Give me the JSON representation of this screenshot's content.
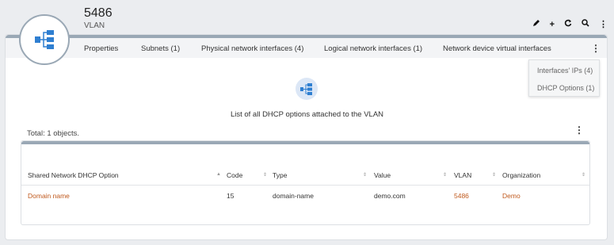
{
  "header": {
    "title": "5486",
    "subtitle": "VLAN",
    "actions": [
      {
        "name": "edit-icon",
        "glyph": "✎"
      },
      {
        "name": "add-icon",
        "glyph": "+"
      },
      {
        "name": "refresh-icon",
        "glyph": "↻"
      },
      {
        "name": "search-icon",
        "glyph": "⚲"
      },
      {
        "name": "more-icon",
        "glyph": "⋮"
      }
    ]
  },
  "tabs": [
    {
      "label": "Properties"
    },
    {
      "label": "Subnets (1)"
    },
    {
      "label": "Physical network interfaces (4)"
    },
    {
      "label": "Logical network interfaces (1)"
    },
    {
      "label": "Network device virtual interfaces"
    }
  ],
  "dropdown": {
    "items": [
      {
        "label": "Interfaces' IPs (4)"
      },
      {
        "label": "DHCP Options (1)"
      }
    ]
  },
  "main": {
    "description": "List of all DHCP options attached to the VLAN",
    "total": "Total: 1 objects."
  },
  "table": {
    "columns": [
      {
        "label": "Shared Network DHCP Option",
        "sort": "▲"
      },
      {
        "label": "Code",
        "sort": "⇕"
      },
      {
        "label": "Type",
        "sort": "⇕"
      },
      {
        "label": "Value",
        "sort": "⇕"
      },
      {
        "label": "VLAN",
        "sort": "⇕"
      },
      {
        "label": "Organization",
        "sort": "⇕"
      }
    ],
    "rows": [
      {
        "option": "Domain name",
        "code": "15",
        "type": "domain-name",
        "value": "demo.com",
        "vlan": "5486",
        "organization": "Demo"
      }
    ]
  },
  "colors": {
    "accent": "#3b82d6",
    "link": "#c05a1e",
    "bar": "#9aa8b5"
  }
}
